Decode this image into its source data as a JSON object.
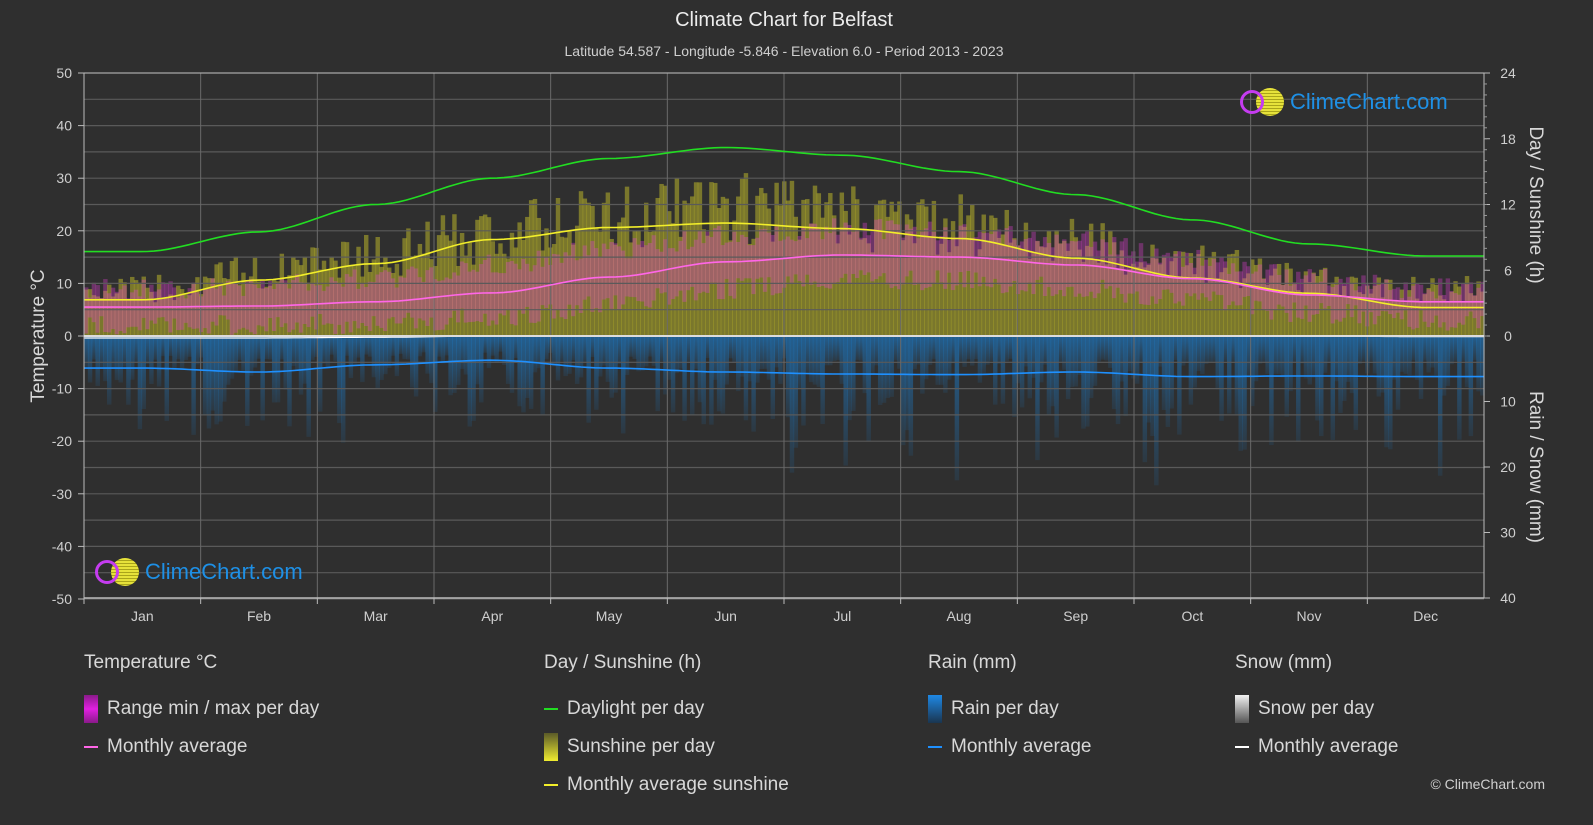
{
  "header": {
    "title": "Climate Chart for Belfast",
    "subtitle": "Latitude 54.587 - Longitude -5.846 - Elevation 6.0 - Period 2013 - 2023"
  },
  "logo": {
    "text": "ClimeChart.com"
  },
  "copyright": "© ClimeChart.com",
  "colors": {
    "background": "#2f2f2f",
    "temp_range": "#e040e0",
    "temp_avg": "#ff66e8",
    "daylight": "#22dd22",
    "sunshine_bar": "#b8b32a",
    "sunshine_avg": "#f2ee2a",
    "rain_bar": "#1f6fb0",
    "rain_avg": "#1e90ff",
    "snow_avg": "#ffffff"
  },
  "legend": {
    "groups": [
      {
        "title": "Temperature °C",
        "items": [
          {
            "label": "Range min / max per day",
            "type": "bar",
            "color": "#e020e0"
          },
          {
            "label": "Monthly average",
            "type": "line",
            "color": "#ff66e8"
          }
        ]
      },
      {
        "title": "Day / Sunshine (h)",
        "items": [
          {
            "label": "Daylight per day",
            "type": "line",
            "color": "#22dd22"
          },
          {
            "label": "Sunshine per day",
            "type": "bar",
            "color": "#e6e23a"
          },
          {
            "label": "Monthly average sunshine",
            "type": "line",
            "color": "#f2ee2a"
          }
        ]
      },
      {
        "title": "Rain (mm)",
        "items": [
          {
            "label": "Rain per day",
            "type": "bar",
            "color": "#1e88e5"
          },
          {
            "label": "Monthly average",
            "type": "line",
            "color": "#1e90ff"
          }
        ]
      },
      {
        "title": "Snow (mm)",
        "items": [
          {
            "label": "Snow per day",
            "type": "bar",
            "color": "#dddddd"
          },
          {
            "label": "Monthly average",
            "type": "line",
            "color": "#ffffff"
          }
        ]
      }
    ]
  },
  "chart_data": {
    "type": "line",
    "title": "Climate Chart for Belfast",
    "categories": [
      "Jan",
      "Feb",
      "Mar",
      "Apr",
      "May",
      "Jun",
      "Jul",
      "Aug",
      "Sep",
      "Oct",
      "Nov",
      "Dec"
    ],
    "axes": {
      "left": {
        "label": "Temperature °C",
        "range": [
          -50,
          50
        ],
        "ticks": [
          50,
          40,
          30,
          20,
          10,
          0,
          -10,
          -20,
          -30,
          -40,
          -50
        ]
      },
      "right_top": {
        "label": "Day / Sunshine (h)",
        "range": [
          0,
          24
        ],
        "ticks": [
          24,
          18,
          12,
          6,
          0
        ]
      },
      "right_bottom": {
        "label": "Rain / Snow (mm)",
        "range": [
          0,
          40
        ],
        "ticks": [
          0,
          10,
          20,
          30,
          40
        ]
      }
    },
    "grid": true,
    "series": [
      {
        "name": "Temperature monthly average (°C)",
        "axis": "left",
        "values": [
          5.5,
          5.7,
          6.5,
          8.2,
          11.2,
          14.1,
          15.4,
          15.0,
          13.5,
          10.9,
          7.8,
          6.5
        ]
      },
      {
        "name": "Temperature daily max envelope (°C)",
        "axis": "left",
        "values": [
          9,
          9.5,
          11,
          13.5,
          16.5,
          19,
          20.5,
          20,
          18,
          14.5,
          11,
          9
        ]
      },
      {
        "name": "Temperature daily min envelope (°C)",
        "axis": "left",
        "values": [
          2,
          2,
          2.5,
          3.5,
          6,
          9,
          11,
          10.5,
          9,
          7,
          4.5,
          3
        ]
      },
      {
        "name": "Daylight per day (h)",
        "axis": "right_top",
        "values": [
          7.7,
          9.5,
          12.0,
          14.4,
          16.2,
          17.2,
          16.5,
          15.0,
          12.9,
          10.6,
          8.4,
          7.3
        ]
      },
      {
        "name": "Sunshine per day max envelope (h)",
        "axis": "right_top",
        "values": [
          5.5,
          7.5,
          9.5,
          12,
          14,
          15,
          14,
          13,
          11,
          8.5,
          6.5,
          5.5
        ]
      },
      {
        "name": "Monthly average sunshine (h)",
        "axis": "right_top",
        "values": [
          3.3,
          5.1,
          6.6,
          8.8,
          9.9,
          10.3,
          9.8,
          8.9,
          7.1,
          5.3,
          3.9,
          2.6
        ]
      },
      {
        "name": "Rain monthly average (mm)",
        "axis": "right_bottom",
        "values": [
          4.9,
          5.5,
          4.4,
          3.7,
          4.9,
          5.5,
          5.8,
          5.9,
          5.5,
          6.2,
          6.1,
          6.2
        ]
      },
      {
        "name": "Snow monthly average (mm)",
        "axis": "right_bottom",
        "values": [
          0.3,
          0.3,
          0.2,
          0,
          0,
          0,
          0,
          0,
          0,
          0,
          0,
          0.1
        ]
      }
    ]
  }
}
